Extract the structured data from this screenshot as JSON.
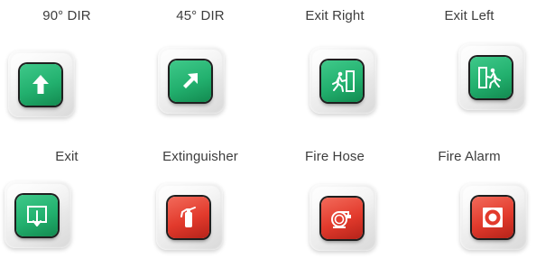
{
  "buttons": [
    {
      "label": "90° DIR",
      "icon": "arrow-up-icon",
      "color": "#22b06e"
    },
    {
      "label": "45° DIR",
      "icon": "arrow-up-right-icon",
      "color": "#22b06e"
    },
    {
      "label": "Exit Right",
      "icon": "exit-right-icon",
      "color": "#22b06e"
    },
    {
      "label": "Exit Left",
      "icon": "exit-left-icon",
      "color": "#22b06e"
    },
    {
      "label": "Exit",
      "icon": "exit-icon",
      "color": "#22b06e"
    },
    {
      "label": "Extinguisher",
      "icon": "fire-extinguisher-icon",
      "color": "#e23a2c"
    },
    {
      "label": "Fire Hose",
      "icon": "fire-hose-icon",
      "color": "#e23a2c"
    },
    {
      "label": "Fire Alarm",
      "icon": "fire-alarm-icon",
      "color": "#e23a2c"
    }
  ]
}
